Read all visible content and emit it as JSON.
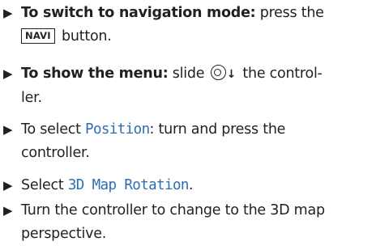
{
  "bullet_glyph": "▶",
  "steps": [
    {
      "bold": "To switch to navigation mode:",
      "text_before_key": " press the",
      "key": "NAVI",
      "text_after_key": " button."
    },
    {
      "bold": "To show the menu:",
      "text_before_icon": " slide",
      "icon_name": "controller-slide-down-icon",
      "arrow": "↓",
      "text_after_icon": " the control-",
      "text_line2": "ler."
    },
    {
      "text_before": "To select ",
      "highlight": "Position",
      "text_after": ": turn and press the",
      "text_line2": "controller."
    },
    {
      "text_before": "Select ",
      "highlight": "3D Map Rotation",
      "text_after": "."
    },
    {
      "text_line1": "Turn the controller to change to the 3D map",
      "text_line2": "perspective."
    }
  ],
  "colors": {
    "text": "#231f20",
    "highlight": "#2e6db4"
  }
}
